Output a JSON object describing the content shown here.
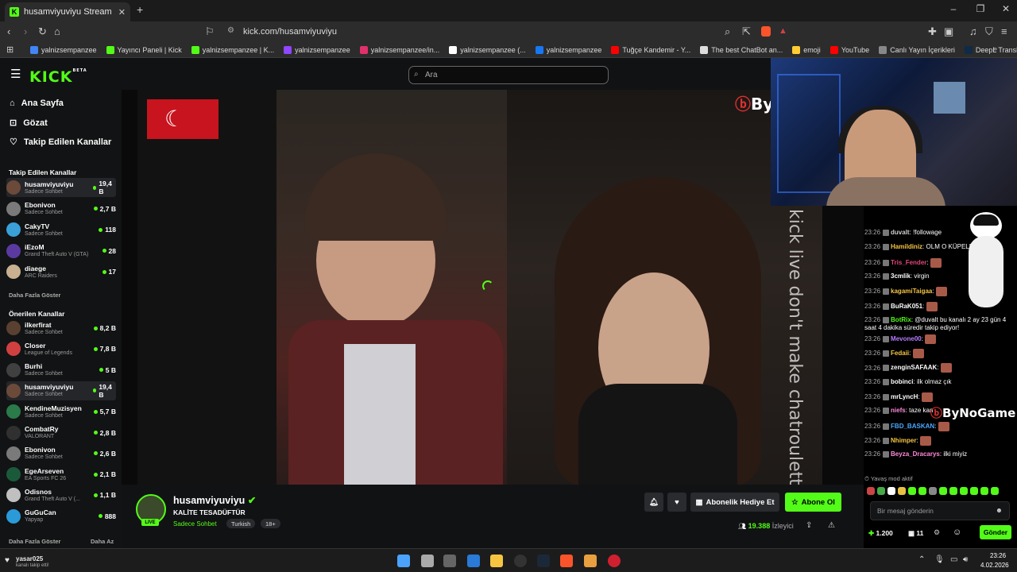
{
  "browser": {
    "tab_title": "husamviyuviyu Stream - Watch Liv",
    "url": "kick.com/husamviyuviyu",
    "bookmarks": [
      {
        "label": "yalnizsempanzee",
        "color": "#4285f4"
      },
      {
        "label": "Yayıncı Paneli | Kick",
        "color": "#53fc18"
      },
      {
        "label": "yalnizsempanzee | K...",
        "color": "#53fc18"
      },
      {
        "label": "yalnizsempanzee",
        "color": "#9146ff"
      },
      {
        "label": "yalnizsempanzee/in...",
        "color": "#e1306c"
      },
      {
        "label": "yalnizsempanzee (...",
        "color": "#ffffff"
      },
      {
        "label": "yalnizsempanzee",
        "color": "#1877f2"
      },
      {
        "label": "Tuğçe Kandemir - Y...",
        "color": "#ff0000"
      },
      {
        "label": "The best ChatBot an...",
        "color": "#dddddd"
      },
      {
        "label": "emoji",
        "color": "#ffcc33"
      },
      {
        "label": "YouTube",
        "color": "#ff0000"
      },
      {
        "label": "Canlı Yayın İçerikleri",
        "color": "#888888"
      },
      {
        "label": "DeepL Translate: Dü...",
        "color": "#0f2b46"
      }
    ]
  },
  "header": {
    "logo": "KICK",
    "logo_sup": "BETA",
    "search_placeholder": "Ara"
  },
  "sidebar": {
    "nav": [
      {
        "label": "Ana Sayfa",
        "icon": "home-icon"
      },
      {
        "label": "Gözat",
        "icon": "browse-icon"
      },
      {
        "label": "Takip Edilen Kanallar",
        "icon": "heart-icon"
      }
    ],
    "followed_title": "Takip Edilen Kanallar",
    "followed": [
      {
        "name": "husamviyuviyu",
        "cat": "Sadece Sohbet",
        "views": "19,4 B",
        "color": "#6b4a3a"
      },
      {
        "name": "Ebonivon",
        "cat": "Sadece Sohbet",
        "views": "2,7 B",
        "color": "#7a7a7a"
      },
      {
        "name": "CakyTV",
        "cat": "Sadece Sohbet",
        "views": "118",
        "color": "#3aa0d8"
      },
      {
        "name": "iEzoM",
        "cat": "Grand Theft Auto V (GTA)",
        "views": "28",
        "color": "#5a3aa0"
      },
      {
        "name": "diaege",
        "cat": "ARC Raiders",
        "views": "17",
        "color": "#c8b090"
      }
    ],
    "show_more": "Daha Fazla Göster",
    "recommended_title": "Önerilen Kanallar",
    "recommended": [
      {
        "name": "ilkerfirat",
        "cat": "Sadece Sohbet",
        "views": "8,2 B",
        "color": "#5a4030"
      },
      {
        "name": "Closer",
        "cat": "League of Legends",
        "views": "7,8 B",
        "color": "#d04040"
      },
      {
        "name": "Burhi",
        "cat": "Sadece Sohbet",
        "views": "5 B",
        "color": "#404040"
      },
      {
        "name": "husamviyuviyu",
        "cat": "Sadece Sohbet",
        "views": "19,4 B",
        "color": "#6b4a3a"
      },
      {
        "name": "KendineMuzisyen",
        "cat": "Sadece Sohbet",
        "views": "5,7 B",
        "color": "#2a7a4a"
      },
      {
        "name": "CombatRy",
        "cat": "VALORANT",
        "views": "2,8 B",
        "color": "#303030"
      },
      {
        "name": "Ebonivon",
        "cat": "Sadece Sohbet",
        "views": "2,6 B",
        "color": "#7a7a7a"
      },
      {
        "name": "EgeArseven",
        "cat": "EA Sports FC 26",
        "views": "2,1 B",
        "color": "#1a5a3a"
      },
      {
        "name": "Odisnos",
        "cat": "Grand Theft Auto V (...",
        "views": "1,1 B",
        "color": "#c0c0c0"
      },
      {
        "name": "GuGuCan",
        "cat": "Yapyap",
        "views": "888",
        "color": "#2a9ad8"
      }
    ],
    "show_more2": "Daha Fazla Göster",
    "show_less": "Daha Az"
  },
  "video": {
    "watermark": "kick live don't make chatroulette",
    "brand": "ByN"
  },
  "stream": {
    "channel": "husamviyuviyu",
    "title": "KALİTE TESADÜFTÜR",
    "category": "Sadece Sohbet",
    "tags": [
      "Turkish",
      "18+"
    ],
    "live_label": "LIVE",
    "gift_label": "Abonelik Hediye Et",
    "sub_label": "Abone Ol",
    "viewers": "19.388",
    "viewers_label": "İzleyici"
  },
  "chat": {
    "messages": [
      {
        "t": "23:26",
        "u": "duvalt",
        "c": "#cfcfcf",
        "m": "!followage"
      },
      {
        "t": "23:26",
        "u": "Hamildiniz",
        "c": "#f5c542",
        "m": "OLM O KÜPELE"
      },
      {
        "t": "23:26",
        "u": "Tris_Fender",
        "c": "#e0457b",
        "m": ""
      },
      {
        "t": "23:26",
        "u": "3cmlik",
        "c": "#ffffff",
        "m": "virgin"
      },
      {
        "t": "23:26",
        "u": "kagamiTaigaa",
        "c": "#f5c542",
        "m": ""
      },
      {
        "t": "23:26",
        "u": "BuRaK051",
        "c": "#ffffff",
        "m": ""
      },
      {
        "t": "23:26",
        "u": "BotRix",
        "c": "#53fc18",
        "m": "@duvalt bu kanalı 2 ay 23 gün 4 saat 4 dakika süredir takip ediyor!"
      },
      {
        "t": "23:26",
        "u": "Mevone00",
        "c": "#b77cff",
        "m": ""
      },
      {
        "t": "23:26",
        "u": "Fedaii",
        "c": "#f5c542",
        "m": ""
      },
      {
        "t": "23:26",
        "u": "zenginSAFAAK",
        "c": "#ffffff",
        "m": ""
      },
      {
        "t": "23:26",
        "u": "bobinci",
        "c": "#ffffff",
        "m": "ilk olmaz çık"
      },
      {
        "t": "23:26",
        "u": "mrLyncH",
        "c": "#ffffff",
        "m": ""
      },
      {
        "t": "23:26",
        "u": "niefs",
        "c": "#ff8ad8",
        "m": "taze kan"
      },
      {
        "t": "23:26",
        "u": "FBD_BASKAN",
        "c": "#4aa8ff",
        "m": ""
      },
      {
        "t": "23:26",
        "u": "Nhimper",
        "c": "#f5c542",
        "m": ""
      },
      {
        "t": "23:26",
        "u": "Beyza_Dracarys",
        "c": "#ff8ad8",
        "m": "ilki miyiz"
      }
    ],
    "slow_mode": "Yavaş mod aktif",
    "input_placeholder": "Bir mesaj gönderin",
    "points": "1.200",
    "gift_count": "11",
    "send_label": "Gönder",
    "brand": "ByNoGame"
  },
  "taskbar": {
    "user": "yasar025",
    "user_sub": "kanalı takip etti!",
    "time": "23:26",
    "date": "4.02.2026"
  }
}
